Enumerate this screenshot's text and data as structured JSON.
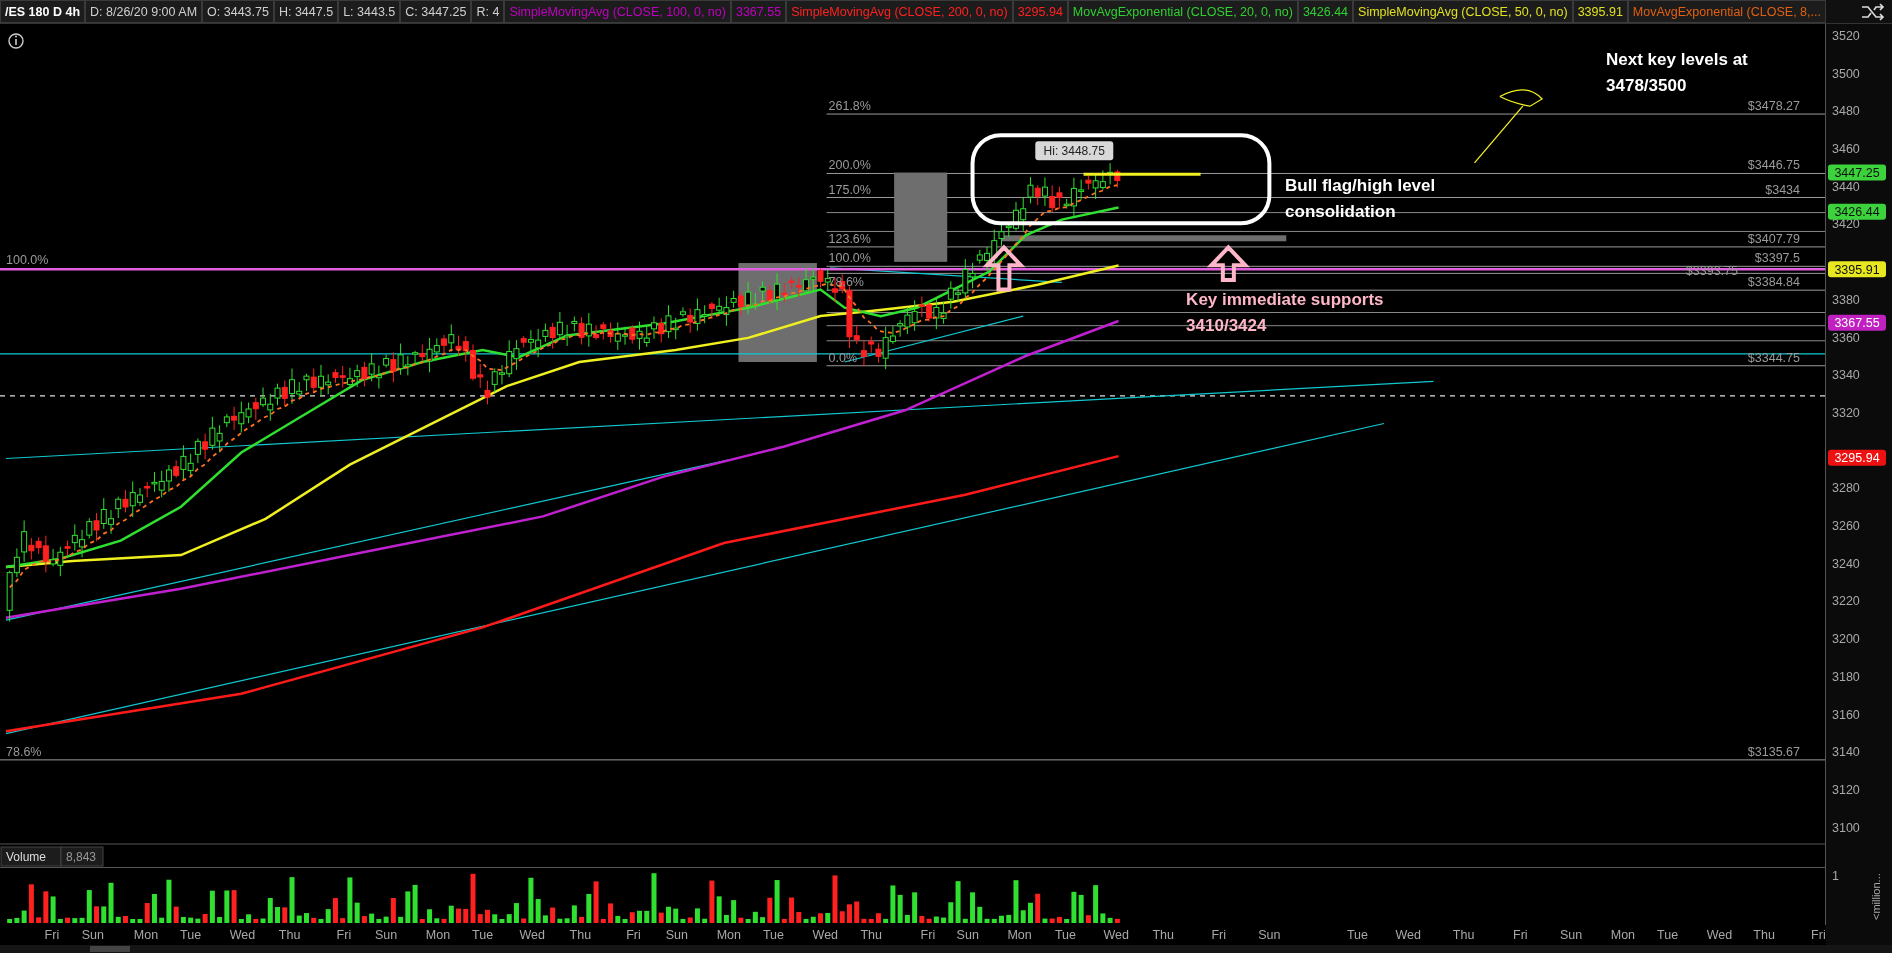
{
  "header": {
    "symbol": "/ES 180 D 4h",
    "fields": [
      "D: 8/26/20 9:00 AM",
      "O: 3443.75",
      "H: 3447.5",
      "L: 3443.5",
      "C: 3447.25",
      "R: 4"
    ],
    "studies": [
      {
        "name": "SimpleMovingAvg (CLOSE, 100, 0, no)",
        "value": "3367.55",
        "color": "#c000c0"
      },
      {
        "name": "SimpleMovingAvg (CLOSE, 200, 0, no)",
        "value": "3295.94",
        "color": "#ff2020"
      },
      {
        "name": "MovAvgExponential (CLOSE, 20, 0, no)",
        "value": "3426.44",
        "color": "#30d030"
      },
      {
        "name": "SimpleMovingAvg (CLOSE, 50, 0, no)",
        "value": "3395.91",
        "color": "#e0e020"
      },
      {
        "name": "MovAvgExponential (CLOSE, 8,...",
        "color": "#e06010"
      }
    ]
  },
  "price_chart": {
    "high_label": "Hi: 3448.75",
    "fib_left": [
      {
        "label": "100.0%"
      },
      {
        "label": "78.6%",
        "price": "$3135.67"
      }
    ],
    "fib_right": [
      {
        "label": "261.8%",
        "price": "$3478.27"
      },
      {
        "label": "200.0%",
        "price": "$3446.75"
      },
      {
        "label": "175.0%",
        "price": "$3434"
      },
      {
        "label": "123.6%",
        "price": "$3407.79"
      },
      {
        "label": "100.0%",
        "price": "$3397.5"
      },
      {
        "price": "$3393.75"
      },
      {
        "label": "78.6%",
        "price": "$3384.84"
      },
      {
        "label": "0.0%",
        "price": "$3344.75"
      }
    ],
    "annotations": [
      {
        "lines": [
          "Next key levels at",
          "3478/3500"
        ],
        "color": "#ffffff"
      },
      {
        "lines": [
          "Bull flag/high level",
          "consolidation"
        ],
        "color": "#ffffff"
      },
      {
        "lines": [
          "Key immediate supports",
          "3410/3424"
        ],
        "color": "#ffb6c8"
      }
    ],
    "price_axis": [
      "3520",
      "3500",
      "3480",
      "3460",
      "3440",
      "3420",
      "3380",
      "3360",
      "3340",
      "3320",
      "3280",
      "3260",
      "3240",
      "3220",
      "3200",
      "3180",
      "3160",
      "3140",
      "3120",
      "3100"
    ],
    "price_markers": [
      {
        "value": "3447.25",
        "color": "#3cd23c"
      },
      {
        "value": "3426.44",
        "color": "#3cd23c"
      },
      {
        "value": "3395.91",
        "color": "#e8e820"
      },
      {
        "value": "3367.55",
        "color": "#c020c0"
      },
      {
        "value": "3295.94",
        "color": "#ee1111"
      }
    ]
  },
  "volume": {
    "title": "Volume",
    "value": "8,843",
    "axis": [
      "1"
    ],
    "unit": "<million..."
  },
  "time_axis": [
    "Fri",
    "Sun",
    "Mon",
    "Tue",
    "Wed",
    "Thu",
    "Fri",
    "Sun",
    "Mon",
    "Tue",
    "Wed",
    "Thu",
    "Fri",
    "Sun",
    "Mon",
    "Tue",
    "Wed",
    "Thu",
    "Fri",
    "Sun",
    "Mon",
    "Tue",
    "Wed",
    "Thu",
    "Fri",
    "Sun",
    "Tue",
    "Wed",
    "Thu",
    "Fri",
    "Sun",
    "Mon",
    "Tue",
    "Wed",
    "Thu",
    "Fri"
  ]
}
